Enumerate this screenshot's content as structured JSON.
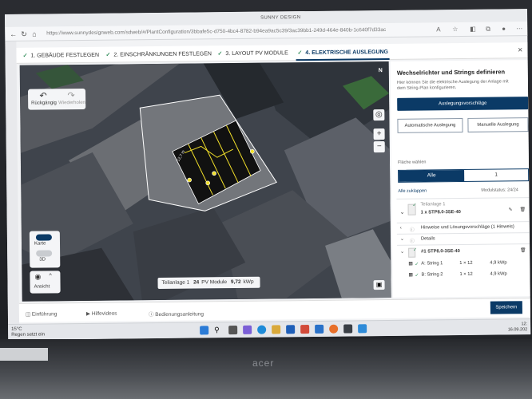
{
  "browser": {
    "window_title": "SUNNY DESIGN",
    "url": "https://www.sunnydesignweb.com/sdweb/#/PlantConfiguration/3bbafe5c-d750-4bc4-8782-b94ea9ac5c39/3ac39bb1-249d-464e-840b-1c640f7d33ac"
  },
  "steps": [
    {
      "label": "1. GEBÄUDE FESTLEGEN"
    },
    {
      "label": "2. EINSCHRÄNKUNGEN FESTLEGEN"
    },
    {
      "label": "3. LAYOUT PV MODULE"
    },
    {
      "label": "4. ELEKTRISCHE AUSLEGUNG"
    }
  ],
  "map": {
    "undo_label": "Rückgängig",
    "redo_label": "Wiederholen",
    "compass": "N",
    "map_toggle": "Karte",
    "view_3d": "3D",
    "view_label": "Ansicht",
    "info": {
      "part": "Teilanlage 1",
      "modules": "24",
      "modules_unit": "PV Module",
      "power": "9,72",
      "power_unit": "kWp"
    }
  },
  "panel": {
    "title": "Wechselrichter und Strings definieren",
    "description": "Hier können Sie die elektrische Auslegung der Anlage mit dem String-Plan konfigurieren.",
    "proposals_button": "Auslegungsvorschläge",
    "auto_button": "Automatische Auslegung",
    "manual_button": "Manuelle Auslegung",
    "area_label": "Fläche wählen",
    "segment_all": "Alle",
    "segment_one": "1",
    "collapse_all": "Alle zuklappen",
    "module_status": "Modulstatus: 24/24",
    "part_label": "Teilanlage 1",
    "inverter_count": "1 x STP8.0-3SE-40",
    "hints": "Hinweise und Lösungsvorschläge (1 Hinweis)",
    "details": "Details",
    "inverter_item": "#1 STP8.0-3SE-40",
    "strings": [
      {
        "name": "A: String 1",
        "config": "1 × 12",
        "power": "4,9 kWp"
      },
      {
        "name": "B: String 2",
        "config": "1 × 12",
        "power": "4,9 kWp"
      }
    ]
  },
  "footer": {
    "intro": "Einführung",
    "videos": "Hilfevideos",
    "manual": "Bedienungsanleitung",
    "save": "Speichern"
  },
  "taskbar": {
    "temp": "15°C",
    "weather": "Regen setzt ein",
    "time": "12:",
    "date": "16.09.202"
  },
  "laptop": {
    "brand": "acer"
  },
  "colors": {
    "primary": "#0b3a66",
    "panel_yellow": "#f2e02a",
    "check_green": "#2e8b57"
  }
}
